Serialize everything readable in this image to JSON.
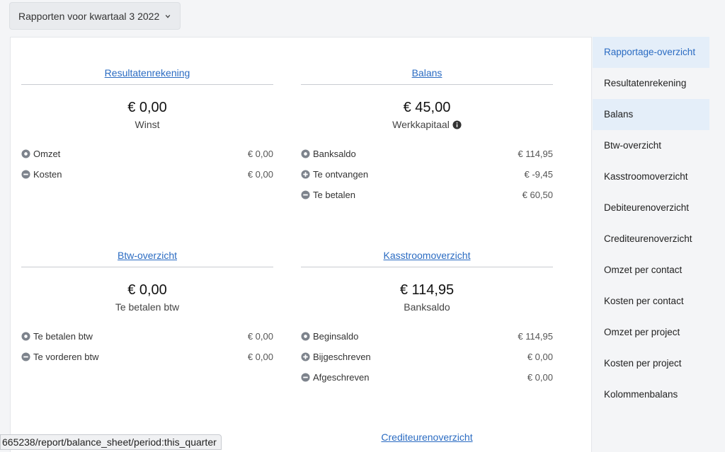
{
  "period_select": {
    "label": "Rapporten voor kwartaal 3 2022",
    "icon": "chevron-down-icon"
  },
  "cards": {
    "resultaten": {
      "title": "Resultatenrekening",
      "amount": "€ 0,00",
      "subtitle": "Winst",
      "rows": [
        {
          "icon": "circle-dot-icon",
          "label": "Omzet",
          "value": "€ 0,00"
        },
        {
          "icon": "minus-circle-icon",
          "label": "Kosten",
          "value": "€ 0,00"
        }
      ]
    },
    "balans": {
      "title": "Balans",
      "amount": "€ 45,00",
      "subtitle": "Werkkapitaal",
      "rows": [
        {
          "icon": "circle-dot-icon",
          "label": "Banksaldo",
          "value": "€ 114,95"
        },
        {
          "icon": "plus-circle-icon",
          "label": "Te ontvangen",
          "value": "€ -9,45"
        },
        {
          "icon": "minus-circle-icon",
          "label": "Te betalen",
          "value": "€ 60,50"
        }
      ]
    },
    "btw": {
      "title": "Btw-overzicht",
      "amount": "€ 0,00",
      "subtitle": "Te betalen btw",
      "rows": [
        {
          "icon": "circle-dot-icon",
          "label": "Te betalen btw",
          "value": "€ 0,00"
        },
        {
          "icon": "minus-circle-icon",
          "label": "Te vorderen btw",
          "value": "€ 0,00"
        }
      ]
    },
    "kasstroom": {
      "title": "Kasstroomoverzicht",
      "amount": "€ 114,95",
      "subtitle": "Banksaldo",
      "rows": [
        {
          "icon": "circle-dot-icon",
          "label": "Beginsaldo",
          "value": "€ 114,95"
        },
        {
          "icon": "plus-circle-icon",
          "label": "Bijgeschreven",
          "value": "€ 0,00"
        },
        {
          "icon": "minus-circle-icon",
          "label": "Afgeschreven",
          "value": "€ 0,00"
        }
      ]
    },
    "crediteuren": {
      "title": "Crediteurenoverzicht"
    }
  },
  "sidebar": {
    "items": [
      {
        "label": "Rapportage-overzicht",
        "state": "active"
      },
      {
        "label": "Resultatenrekening",
        "state": ""
      },
      {
        "label": "Balans",
        "state": "selected"
      },
      {
        "label": "Btw-overzicht",
        "state": ""
      },
      {
        "label": "Kasstroomoverzicht",
        "state": ""
      },
      {
        "label": "Debiteurenoverzicht",
        "state": ""
      },
      {
        "label": "Crediteurenoverzicht",
        "state": ""
      },
      {
        "label": "Omzet per contact",
        "state": ""
      },
      {
        "label": "Kosten per contact",
        "state": ""
      },
      {
        "label": "Omzet per project",
        "state": ""
      },
      {
        "label": "Kosten per project",
        "state": ""
      },
      {
        "label": "Kolommenbalans",
        "state": ""
      }
    ]
  },
  "status_bar": {
    "url": "665238/report/balance_sheet/period:this_quarter"
  },
  "colors": {
    "link": "#2a6bc2",
    "icon": "#7d838c",
    "active_bg": "#e4eef9"
  }
}
